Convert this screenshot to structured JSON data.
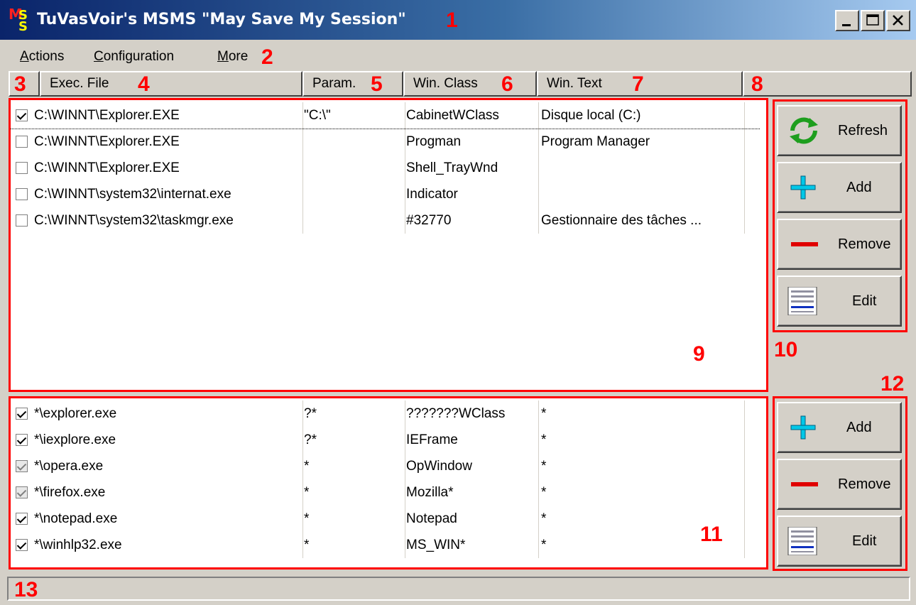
{
  "window": {
    "title": "TuVasVoir's MSMS \"May Save My Session\"",
    "icon_letters": {
      "m": "M",
      "s1": "S",
      "s2": "S"
    },
    "controls": [
      "minimize-icon",
      "maximize-icon",
      "close-icon"
    ]
  },
  "menu": {
    "actions": {
      "underline": "A",
      "rest": "ctions"
    },
    "configuration": {
      "underline": "C",
      "rest": "onfiguration"
    },
    "more": {
      "underline": "M",
      "rest": "ore"
    }
  },
  "columns": {
    "exec_file": "Exec. File",
    "param": "Param.",
    "win_class": "Win. Class",
    "win_text": "Win. Text"
  },
  "sessions": [
    {
      "checked": true,
      "state": "checked",
      "exec": "C:\\WINNT\\Explorer.EXE",
      "param": "\"C:\\\"",
      "win_class": "CabinetWClass",
      "win_text": "Disque local (C:)"
    },
    {
      "checked": false,
      "state": "unchecked",
      "exec": "C:\\WINNT\\Explorer.EXE",
      "param": "",
      "win_class": "Progman",
      "win_text": "Program Manager"
    },
    {
      "checked": false,
      "state": "unchecked",
      "exec": "C:\\WINNT\\Explorer.EXE",
      "param": "",
      "win_class": "Shell_TrayWnd",
      "win_text": ""
    },
    {
      "checked": false,
      "state": "unchecked",
      "exec": "C:\\WINNT\\system32\\internat.exe",
      "param": "",
      "win_class": "Indicator",
      "win_text": ""
    },
    {
      "checked": false,
      "state": "unchecked",
      "exec": "C:\\WINNT\\system32\\taskmgr.exe",
      "param": "",
      "win_class": "#32770",
      "win_text": "Gestionnaire des tâches ..."
    }
  ],
  "filters": [
    {
      "state": "checked",
      "exec": "*\\explorer.exe",
      "param": "?*",
      "win_class": "???????WClass",
      "win_text": "*"
    },
    {
      "state": "checked",
      "exec": "*\\iexplore.exe",
      "param": "?*",
      "win_class": "IEFrame",
      "win_text": "*"
    },
    {
      "state": "grayed",
      "exec": "*\\opera.exe",
      "param": "*",
      "win_class": "OpWindow",
      "win_text": "*"
    },
    {
      "state": "grayed",
      "exec": "*\\firefox.exe",
      "param": "*",
      "win_class": "Mozilla*",
      "win_text": "*"
    },
    {
      "state": "checked",
      "exec": "*\\notepad.exe",
      "param": "*",
      "win_class": "Notepad",
      "win_text": "*"
    },
    {
      "state": "checked",
      "exec": "*\\winhlp32.exe",
      "param": "*",
      "win_class": "MS_WIN*",
      "win_text": "*"
    }
  ],
  "session_buttons": {
    "refresh": "Refresh",
    "add": "Add",
    "remove": "Remove",
    "edit": "Edit"
  },
  "filter_buttons": {
    "add": "Add",
    "remove": "Remove",
    "edit": "Edit"
  },
  "callouts": {
    "c1": "1",
    "c2": "2",
    "c3": "3",
    "c4": "4",
    "c5": "5",
    "c6": "6",
    "c7": "7",
    "c8": "8",
    "c9": "9",
    "c10": "10",
    "c11": "11",
    "c12": "12",
    "c13": "13"
  },
  "colors": {
    "highlight_red": "#ff0000",
    "window_face": "#d4d0c8",
    "title_start": "#0a246a",
    "title_end": "#a6caf0",
    "refresh_green": "#1e9e1e",
    "add_cyan": "#00c8e8",
    "remove_red": "#e00000"
  }
}
